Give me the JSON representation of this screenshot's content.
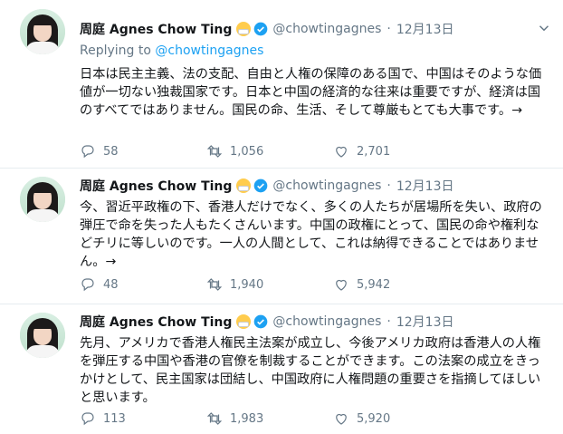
{
  "tweets": [
    {
      "name": "周庭 Agnes Chow Ting",
      "handle": "@chowtingagnes",
      "time": "12月13日",
      "reply_label": "Replying to",
      "reply_handle": "@chowtingagnes",
      "text": "日本は民主主義、法の支配、自由と人権の保障のある国で、中国はそのような価値が一切ない独裁国家です。日本と中国の経済的な往来は重要ですが、経済は国のすべてではありません。国民の命、生活、そして尊厳もとても大事です。→",
      "replies": "58",
      "retweets": "1,056",
      "likes": "2,701"
    },
    {
      "name": "周庭 Agnes Chow Ting",
      "handle": "@chowtingagnes",
      "time": "12月13日",
      "text": "今、習近平政権の下、香港人だけでなく、多くの人たちが居場所を失い、政府の弾圧で命を失った人もたくさんいます。中国の政権にとって、国民の命や権利などチリに等しいのです。一人の人間として、これは納得できることではありません。→",
      "replies": "48",
      "retweets": "1,940",
      "likes": "5,942"
    },
    {
      "name": "周庭 Agnes Chow Ting",
      "handle": "@chowtingagnes",
      "time": "12月13日",
      "text": "先月、アメリカで香港人権民主法案が成立し、今後アメリカ政府は香港人の人権を弾圧する中国や香港の官僚を制裁することができます。この法案の成立をきっかけとして、民主国家は団結し、中国政府に人権問題の重要さを指摘してほしいと思います。",
      "replies": "113",
      "retweets": "1,983",
      "likes": "5,920"
    }
  ],
  "icons": {
    "reply": "reply-icon",
    "retweet": "retweet-icon",
    "like": "like-icon",
    "share": "share-icon",
    "verified": "verified-badge-icon",
    "emoji": "mask-face-emoji-icon",
    "menu": "chevron-down-icon"
  },
  "colors": {
    "accent": "#1da1f2",
    "muted": "#657786",
    "text": "#14171a"
  }
}
